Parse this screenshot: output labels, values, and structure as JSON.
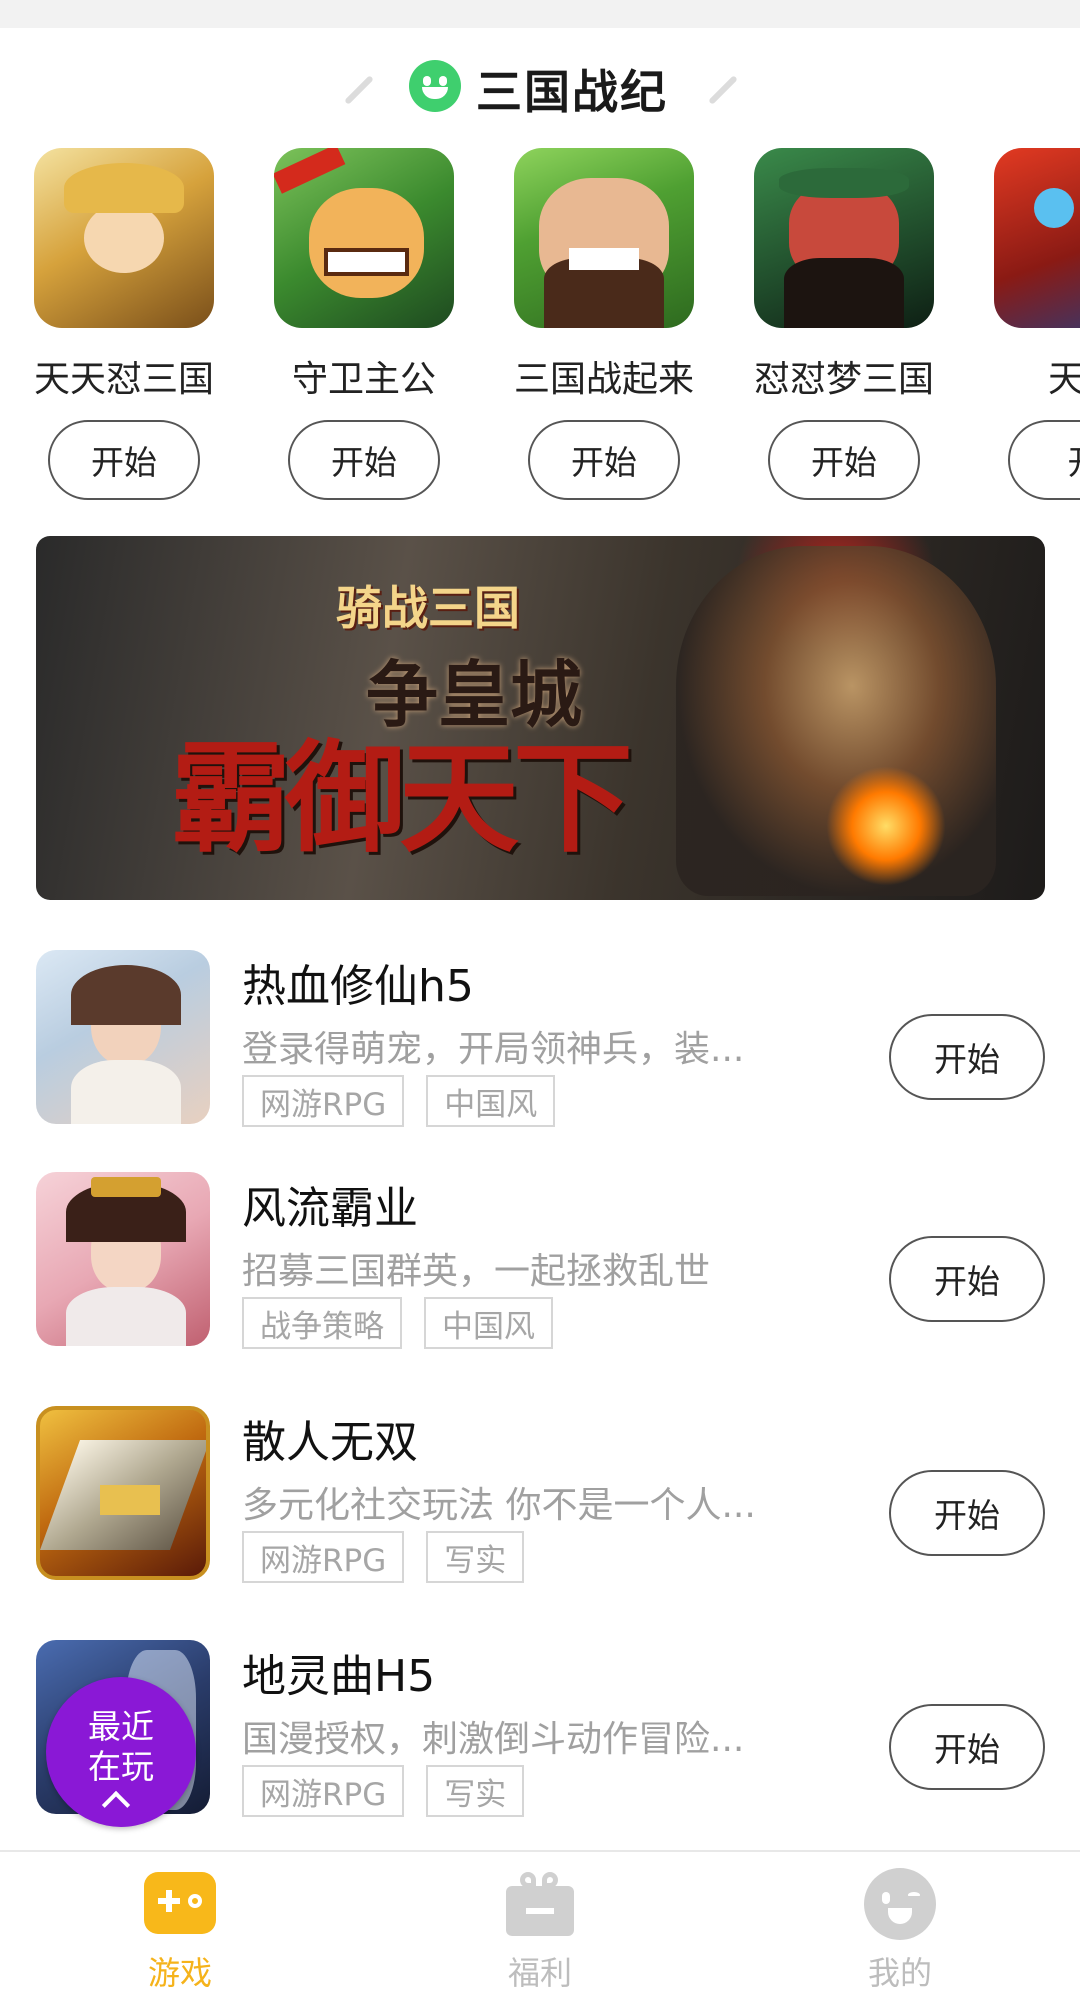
{
  "section": {
    "title": "三国战纪"
  },
  "featured_games": [
    {
      "name": "天天怼三国",
      "button": "开始",
      "icon_colors": [
        "#e8c46a",
        "#8a5a20"
      ]
    },
    {
      "name": "守卫主公",
      "button": "开始",
      "icon_colors": [
        "#4c9a3a",
        "#f0a030"
      ]
    },
    {
      "name": "三国战起来",
      "button": "开始",
      "icon_colors": [
        "#6cc04a",
        "#e7b48a"
      ]
    },
    {
      "name": "怼怼梦三国",
      "button": "开始",
      "icon_colors": [
        "#2f6a3a",
        "#c4483a"
      ]
    },
    {
      "name": "天途",
      "button": "开",
      "icon_colors": [
        "#c23020",
        "#2a4a8a"
      ]
    }
  ],
  "banner": {
    "subtitle": "骑战三国",
    "headline_small": "争皇城",
    "headline_large": "霸御天下"
  },
  "games": [
    {
      "title": "热血修仙h5",
      "desc": "登录得萌宠，开局领神兵，装...",
      "tags": [
        "网游RPG",
        "中国风"
      ],
      "button": "开始",
      "icon_colors": [
        "#d8e6f2",
        "#e7b9a3"
      ]
    },
    {
      "title": "风流霸业",
      "desc": "招募三国群英，一起拯救乱世",
      "tags": [
        "战争策略",
        "中国风"
      ],
      "button": "开始",
      "icon_colors": [
        "#f4c4cc",
        "#b03040"
      ]
    },
    {
      "title": "散人无双",
      "desc": "多元化社交玩法 你不是一个人...",
      "tags": [
        "网游RPG",
        "写实"
      ],
      "button": "开始",
      "icon_colors": [
        "#d9a028",
        "#8a1e10"
      ]
    },
    {
      "title": "地灵曲H5",
      "desc": "国漫授权，刺激倒斗动作冒险...",
      "tags": [
        "网游RPG",
        "写实"
      ],
      "button": "开始",
      "icon_colors": [
        "#3a5ca0",
        "#1a2240"
      ]
    }
  ],
  "recent": {
    "line1": "最近",
    "line2": "在玩"
  },
  "tabs": [
    {
      "label": "游戏",
      "icon": "gamepad-icon",
      "active": true
    },
    {
      "label": "福利",
      "icon": "gift-icon",
      "active": false
    },
    {
      "label": "我的",
      "icon": "face-icon",
      "active": false
    }
  ],
  "colors": {
    "accent": "#f5b31b",
    "recent_bg": "#8a18d6",
    "section_icon": "#3fcf6e"
  }
}
